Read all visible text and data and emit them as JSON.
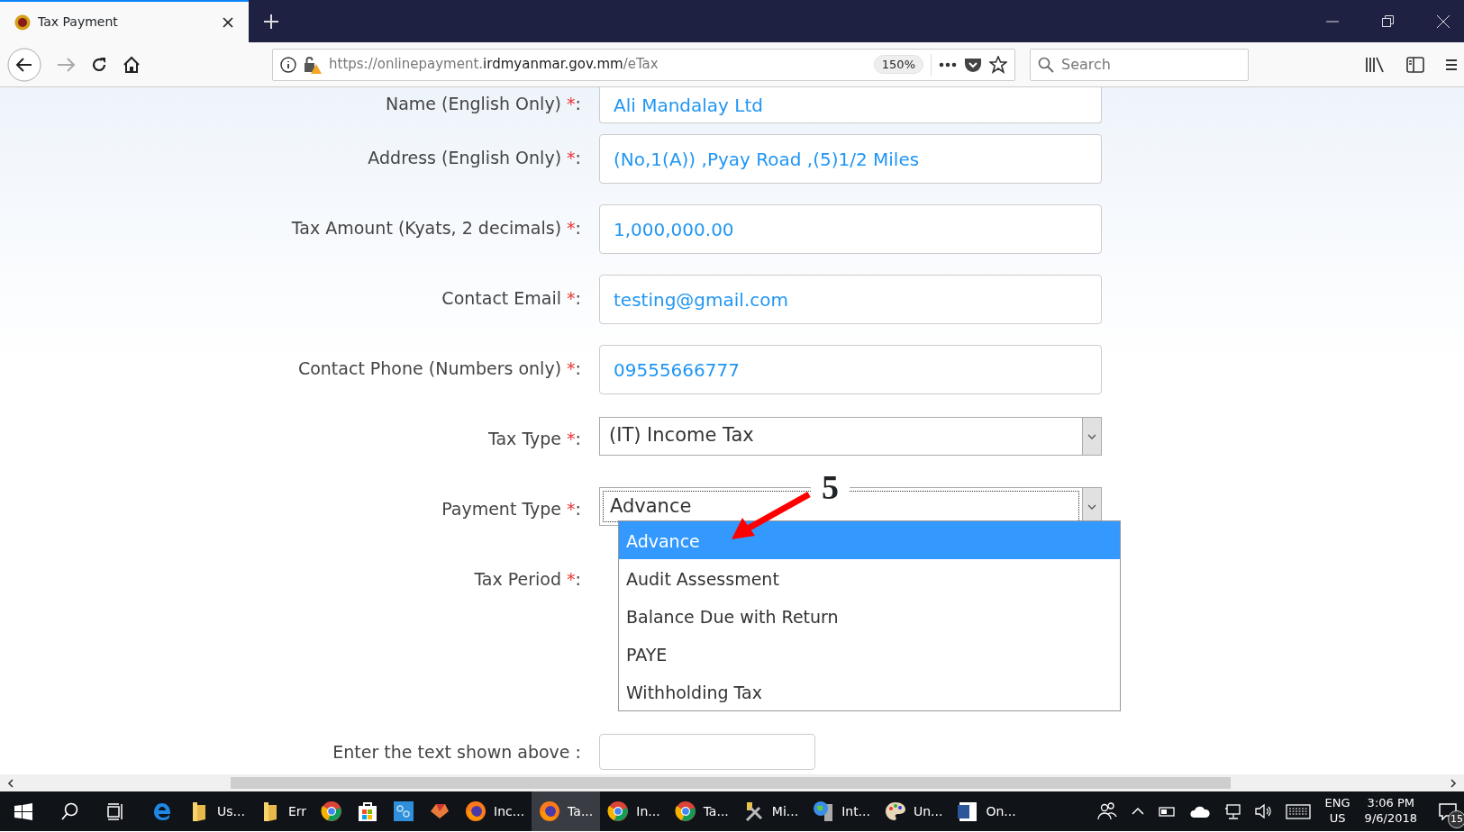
{
  "browser": {
    "tab_title": "Tax Payment",
    "url": {
      "scheme": "https://onlinepayment.",
      "domain": "irdmyanmar.gov.mm",
      "path": "/eTax"
    },
    "zoom": "150%",
    "search": {
      "placeholder": "Search"
    }
  },
  "form": {
    "fields": [
      {
        "kind": "text",
        "label": "Name (English Only)",
        "required_mark": "*",
        "colon": ":",
        "value": "Ali Mandalay Ltd"
      },
      {
        "kind": "text",
        "label": "Address (English Only)",
        "required_mark": "*",
        "colon": ":",
        "value": "(No,1(A)) ,Pyay Road ,(5)1/2 Miles"
      },
      {
        "kind": "text",
        "label": "Tax Amount (Kyats, 2 decimals)",
        "required_mark": "*",
        "colon": ":",
        "value": "1,000,000.00"
      },
      {
        "kind": "text",
        "label": "Contact Email",
        "required_mark": "*",
        "colon": ":",
        "value": "testing@gmail.com"
      },
      {
        "kind": "text",
        "label": "Contact Phone (Numbers only)",
        "required_mark": "*",
        "colon": ":",
        "value": "09555666777"
      },
      {
        "kind": "select",
        "label": "Tax Type",
        "required_mark": "*",
        "colon": ":",
        "value": "(IT) Income Tax",
        "focused": false
      },
      {
        "kind": "select",
        "label": "Payment Type",
        "required_mark": "*",
        "colon": ":",
        "value": "Advance",
        "focused": true
      },
      {
        "kind": "covered",
        "label": "Tax Period",
        "required_mark": "*",
        "colon": ":"
      },
      {
        "kind": "captcha",
        "label": "Enter the text shown above :"
      }
    ]
  },
  "dropdown": {
    "options": [
      {
        "label": "Advance",
        "selected": true
      },
      {
        "label": "Audit Assessment",
        "selected": false
      },
      {
        "label": "Balance Due with Return",
        "selected": false
      },
      {
        "label": "PAYE",
        "selected": false
      },
      {
        "label": "Withholding Tax",
        "selected": false
      }
    ]
  },
  "annotation": {
    "number": "5"
  },
  "taskbar": {
    "apps": [
      {
        "kind": "edge",
        "selected": false
      },
      {
        "kind": "folder",
        "label": "Us...",
        "selected": false
      },
      {
        "kind": "folder",
        "label": "Err",
        "selected": false
      },
      {
        "kind": "chrome",
        "selected": false
      },
      {
        "kind": "store",
        "selected": false
      },
      {
        "kind": "tile",
        "selected": false
      },
      {
        "kind": "gem",
        "selected": false
      },
      {
        "kind": "firefox",
        "label": "Inc...",
        "selected": false
      },
      {
        "kind": "firefox",
        "label": "Ta...",
        "selected": true
      },
      {
        "kind": "chrome",
        "label": "In...",
        "selected": false
      },
      {
        "kind": "chrome",
        "label": "Ta...",
        "selected": false
      },
      {
        "kind": "tools",
        "label": "Mi...",
        "selected": false
      },
      {
        "kind": "globe",
        "label": "Int...",
        "selected": false
      },
      {
        "kind": "palette",
        "label": "Un...",
        "selected": false
      },
      {
        "kind": "word",
        "label": "On...",
        "selected": false
      }
    ],
    "language": [
      "ENG",
      "US"
    ],
    "time": "3:06 PM",
    "date": "9/6/2018",
    "notifications": "15"
  }
}
